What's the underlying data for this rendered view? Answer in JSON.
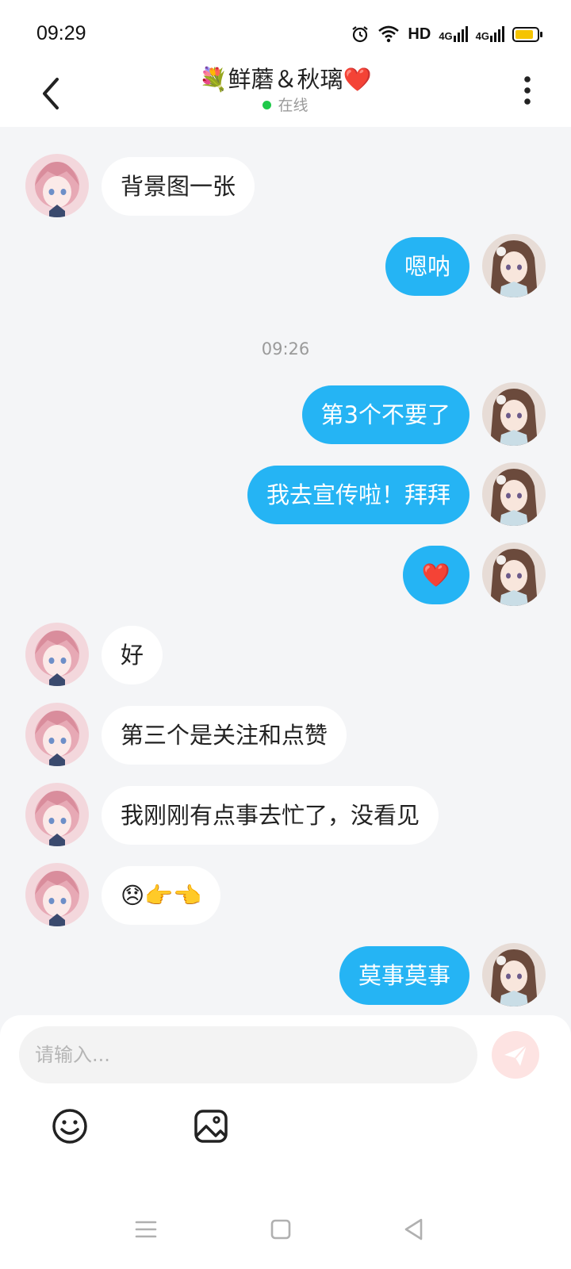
{
  "status_bar": {
    "time": "09:29",
    "network_label": "HD",
    "signal_1_label": "4G",
    "signal_2_label": "4G",
    "battery_level": 0.9,
    "battery_color": "#f5c400"
  },
  "header": {
    "title": "💐鲜蘑＆秋璃❤️",
    "status": "在线",
    "status_color": "#1fc94a"
  },
  "messages": [
    {
      "side": "left",
      "text": "背景图一张"
    },
    {
      "side": "right",
      "text": "嗯呐"
    },
    {
      "side": "right",
      "text": "第3个不要了"
    },
    {
      "side": "right",
      "text": "我去宣传啦！拜拜"
    },
    {
      "side": "right",
      "text": "❤️"
    },
    {
      "side": "left",
      "text": "好"
    },
    {
      "side": "left",
      "text": "第三个是关注和点赞"
    },
    {
      "side": "left",
      "text": "我刚刚有点事去忙了，没看见"
    },
    {
      "side": "left",
      "text": "😞👉👈"
    },
    {
      "side": "right",
      "text": "莫事莫事"
    }
  ],
  "timestamp": "09:26",
  "composer": {
    "placeholder": "请输入...",
    "value": "",
    "send_color": "#fde3e2"
  },
  "icons": {
    "back": "chevron-left-icon",
    "more": "more-vertical-icon",
    "emoji": "smiley-icon",
    "image": "image-icon",
    "send": "paper-plane-icon",
    "nav_menu": "menu-icon",
    "nav_home": "square-icon",
    "nav_back": "triangle-back-icon"
  },
  "colors": {
    "bubble_self": "#25b4f4",
    "bubble_other": "#ffffff",
    "background": "#f4f5f7"
  }
}
